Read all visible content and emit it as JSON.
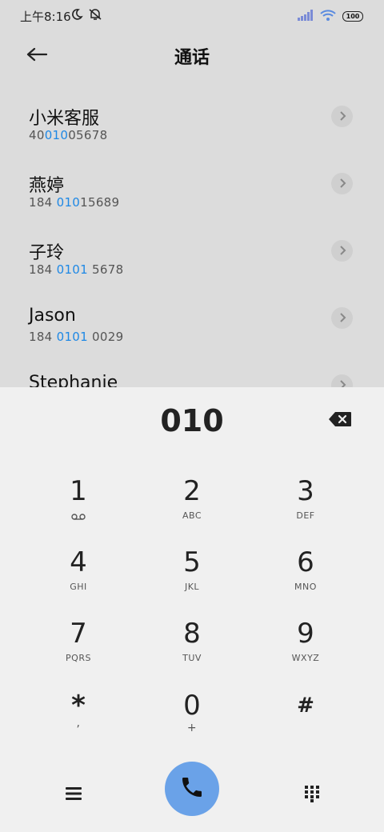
{
  "status": {
    "time": "上午8:16",
    "battery": "100"
  },
  "header": {
    "title": "通话"
  },
  "contacts": [
    {
      "name": "小米客服",
      "number_pre": "40",
      "number_hl": "010",
      "number_post": "05678"
    },
    {
      "name": "燕婷",
      "number_pre": "184 ",
      "number_hl": "010",
      "number_post": "15689"
    },
    {
      "name": "子玲",
      "number_pre": "184 ",
      "number_hl": "0101",
      "number_post": " 5678"
    },
    {
      "name": "Jason",
      "number_pre": "184 ",
      "number_hl": "0101",
      "number_post": " 0029"
    },
    {
      "name": "Stephanie",
      "number_pre": "",
      "number_hl": "",
      "number_post": ""
    }
  ],
  "dialer": {
    "input": "010",
    "keys": [
      {
        "digit": "1",
        "letters": ""
      },
      {
        "digit": "2",
        "letters": "ABC"
      },
      {
        "digit": "3",
        "letters": "DEF"
      },
      {
        "digit": "4",
        "letters": "GHI"
      },
      {
        "digit": "5",
        "letters": "JKL"
      },
      {
        "digit": "6",
        "letters": "MNO"
      },
      {
        "digit": "7",
        "letters": "PQRS"
      },
      {
        "digit": "8",
        "letters": "TUV"
      },
      {
        "digit": "9",
        "letters": "WXYZ"
      },
      {
        "digit": "*",
        "letters": ","
      },
      {
        "digit": "0",
        "letters": "+"
      },
      {
        "digit": "#",
        "letters": ""
      }
    ]
  },
  "colors": {
    "highlight": "#1e88e5",
    "call_button": "#6aa2e8",
    "list_background": "#dcdcdc",
    "keypad_background": "#f0f0f0"
  },
  "icons": {
    "back": "arrow-left-icon",
    "chevron": "chevron-right-icon",
    "backspace": "backspace-icon",
    "voicemail": "voicemail-icon",
    "menu": "menu-icon",
    "call": "phone-icon",
    "keypad": "dialpad-icon"
  }
}
